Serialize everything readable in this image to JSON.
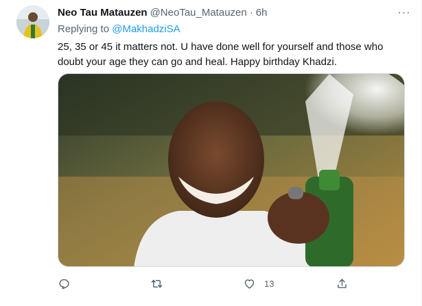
{
  "tweet": {
    "display_name": "Neo Tau Matauzen",
    "handle": "@NeoTau_Matauzen",
    "separator": "·",
    "time": "6h",
    "replying_prefix": "Replying to ",
    "replying_to": "@MakhadziSA",
    "text": "25, 35 or 45 it matters not. U have done well for yourself and those who doubt your age they can go and heal. Happy birthday Khadzi.",
    "more_label": "···"
  },
  "actions": {
    "reply_icon": "reply-icon",
    "retweet_icon": "retweet-icon",
    "like_icon": "heart-icon",
    "like_count": "13",
    "share_icon": "share-icon"
  },
  "colors": {
    "accent": "#1d9bf0",
    "secondary_text": "#536471",
    "primary_text": "#0f1419"
  }
}
